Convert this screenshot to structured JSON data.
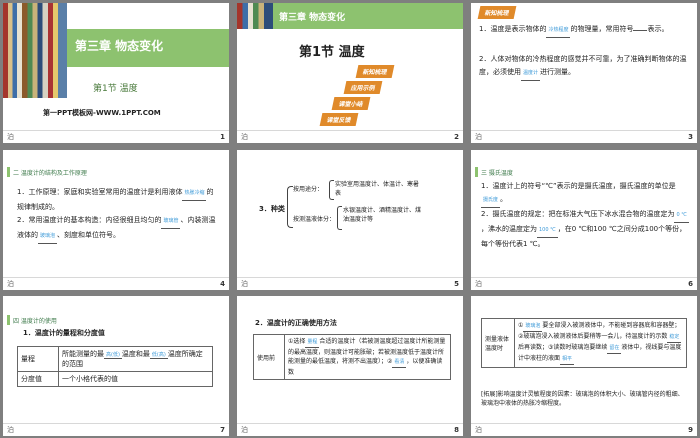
{
  "slides": [
    {
      "number": "1",
      "chapter": "第三章 物态变化",
      "section": "第1节 温度",
      "site": "第一PPT模板网-WWW.1PPT.COM",
      "footer": "泊"
    },
    {
      "number": "2",
      "chapter": "第三章 物态变化",
      "section": "第1节 温度",
      "footer": "泊",
      "badges": [
        "新知梳理",
        "应用示例",
        "课堂小结",
        "课堂反馈"
      ]
    },
    {
      "number": "3",
      "badge": "新知梳理",
      "footer": "泊",
      "p1": "1．温度是表示物体的",
      "p1_fill": "冷热程度",
      "p1b": "的物理量，常用符号",
      "p1c": "表示。",
      "p2": "2．人体对物体的冷热程度的感觉并不可靠，为了准确判断物体的温度，必须使用",
      "p2_fill": "温度计",
      "p2b": "进行测量。"
    },
    {
      "number": "4",
      "header": "二 温度计的结构及工作原理",
      "footer": "泊",
      "p1": "1．工作原理：家庭和实验室常用的温度计是利用液体",
      "p1_fill": "热胀冷缩",
      "p1b": "的规律制成的。",
      "p2": "2．常用温度计的基本构造：内径很细且均匀的",
      "p2_fill1": "玻璃管",
      "p2b": "、内装测温液体的",
      "p2_fill2": "玻璃泡",
      "p2c": "、刻度和单位符号。"
    },
    {
      "number": "5",
      "footer": "泊",
      "label": "3．种类",
      "row1_label": "按用途分：",
      "row1_text": "实验室用温度计、体温计、寒暑表",
      "row2_label": "按测温液体分：",
      "row2_text": "水银温度计、酒精温度计、煤油温度计等"
    },
    {
      "number": "6",
      "header": "三 摄氏温度",
      "footer": "泊",
      "p1": "1．温度计上的符号“℃”表示的是摄氏温度，摄氏温度的单位是",
      "p1_fill": "摄氏度",
      "p1b": "。",
      "p2": "2．摄氏温度的规定：把在标准大气压下冰水混合物的温度定为",
      "p2_fill1": "0 ℃",
      "p2b": "，沸水的温度定为",
      "p2_fill2": "100 ℃",
      "p2c": "，在0 ℃和100 ℃之间分成100个等份，每个等份代表1 ℃。"
    },
    {
      "number": "7",
      "header": "四 温度计的使用",
      "footer": "泊",
      "title": "1．温度计的量程和分度值",
      "table": [
        {
          "k": "量程",
          "v1": "所能测量的最",
          "f1": "高(低)",
          "v2": "温度和最",
          "f2": "低(高)",
          "v3": "温度所确定的范围"
        },
        {
          "k": "分度值",
          "v": "一个小格代表的值"
        }
      ]
    },
    {
      "number": "8",
      "footer": "泊",
      "title": "2．温度计的正确使用方法",
      "rowlabel": "使用前",
      "text1": "①选择",
      "fill1": "量程",
      "text2": "合适的温度计（若被测温度超过温度计所能测量的最高温度，则温度计可能胀破；若被测温度低于温度计所能测量的最低温度，将测不出温度）；②",
      "fill2": "看清",
      "text3": "，以便准确读数"
    },
    {
      "number": "9",
      "footer": "泊",
      "rowlabel": "测量液体温度时",
      "text1": "①",
      "fill1": "玻璃泡",
      "text2": "要全部浸入被测液体中，不能碰到容器底和容器壁；②玻璃泡浸入被测液体后要稍等一会儿，待温度计的示数",
      "fill2": "稳定",
      "text3": "后再读数；③读数时玻璃泡要继续",
      "fill3": "留在",
      "text4": "液体中，视线要与温度计中液柱的液面",
      "fill4": "相平",
      "note": "[拓展]影响温度计灵敏程度的因素：玻璃泡的体积大小、玻璃管内径的粗细、玻璃泡中液体的热胀冷缩程度。"
    }
  ],
  "colors": {
    "green": "#8dc26f",
    "dark_green": "#3d7a4a",
    "orange": "#e08a2a",
    "fill_blue": "#3d9ad8",
    "bg": "#7f7f7f"
  }
}
